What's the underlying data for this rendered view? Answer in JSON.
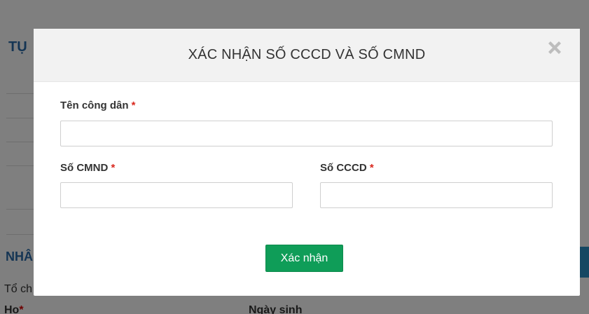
{
  "background": {
    "section_1_title": "TỤ",
    "section_2_title": "NHÂ",
    "tochuc_text": "Tổ ch",
    "ho_label": "Họ",
    "ngaysinh_label": "Ngày sinh"
  },
  "modal": {
    "title": "XÁC NHẬN SỐ CCCD VÀ SỐ CMND",
    "close_icon": "close-x-icon",
    "required_marker": "*",
    "fields": {
      "citizen_name": {
        "label": "Tên công dân",
        "value": "",
        "placeholder": ""
      },
      "cmnd": {
        "label": "Số CMND",
        "value": "",
        "placeholder": ""
      },
      "cccd": {
        "label": "Số CCCD",
        "value": "",
        "placeholder": ""
      }
    },
    "confirm_label": "Xác nhận"
  },
  "colors": {
    "primary_button": "#0f9d58",
    "required": "#d9281e",
    "header_bg": "#f2f2f2"
  }
}
